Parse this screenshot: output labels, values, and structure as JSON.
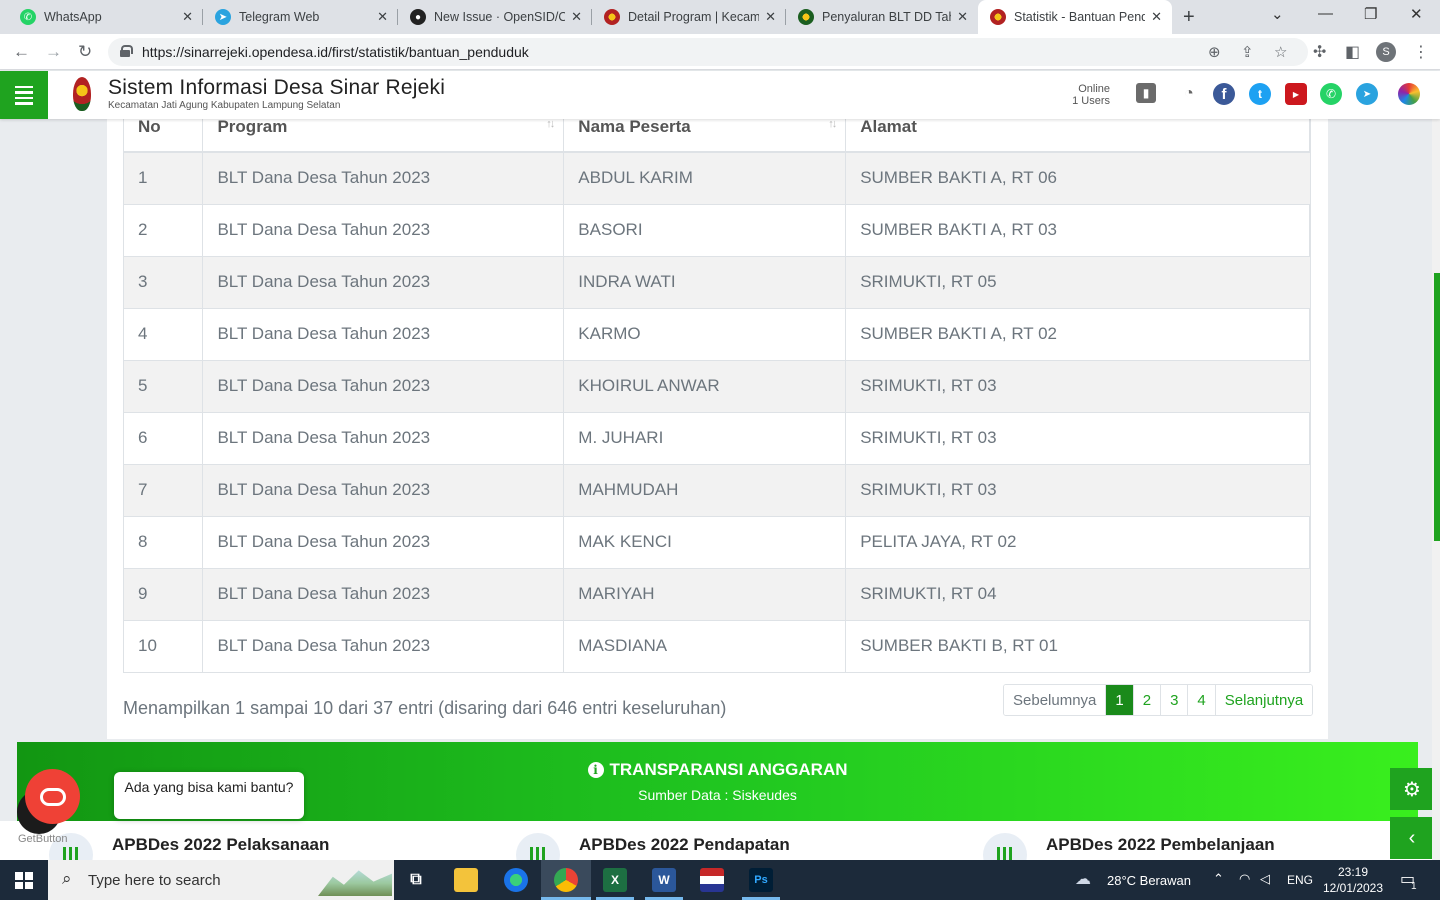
{
  "browser": {
    "tabs": [
      {
        "title": "WhatsApp",
        "icon": "whatsapp-icon",
        "color": "#25d366"
      },
      {
        "title": "Telegram Web",
        "icon": "telegram-icon",
        "color": "#2aa3df"
      },
      {
        "title": "New Issue · OpenSID/Op",
        "icon": "github-icon",
        "color": "#222222"
      },
      {
        "title": "Detail Program | Kecama",
        "icon": "site-favicon",
        "color": "#b22222"
      },
      {
        "title": "Penyaluran BLT DD Tahu",
        "icon": "site-favicon",
        "color": "#b22222"
      },
      {
        "title": "Statistik - Bantuan Pend",
        "icon": "site-favicon",
        "color": "#b22222"
      }
    ],
    "url": "https://sinarrejeki.opendesa.id/first/statistik/bantuan_penduduk",
    "profile_initial": "S"
  },
  "site": {
    "title": "Sistem Informasi Desa Sinar Rejeki",
    "subtitle": "Kecamatan Jati Agung  Kabupaten Lampung Selatan",
    "online_label": "Online",
    "online_users": "1 Users"
  },
  "table": {
    "headers": {
      "no": "No",
      "program": "Program",
      "nama": "Nama Peserta",
      "alamat": "Alamat"
    },
    "rows": [
      {
        "no": "1",
        "program": "BLT Dana Desa Tahun 2023",
        "nama": "ABDUL KARIM",
        "alamat": "SUMBER BAKTI A, RT 06"
      },
      {
        "no": "2",
        "program": "BLT Dana Desa Tahun 2023",
        "nama": "BASORI",
        "alamat": "SUMBER BAKTI A, RT 03"
      },
      {
        "no": "3",
        "program": "BLT Dana Desa Tahun 2023",
        "nama": "INDRA WATI",
        "alamat": "SRIMUKTI, RT 05"
      },
      {
        "no": "4",
        "program": "BLT Dana Desa Tahun 2023",
        "nama": "KARMO",
        "alamat": "SUMBER BAKTI A, RT 02"
      },
      {
        "no": "5",
        "program": "BLT Dana Desa Tahun 2023",
        "nama": "KHOIRUL ANWAR",
        "alamat": "SRIMUKTI, RT 03"
      },
      {
        "no": "6",
        "program": "BLT Dana Desa Tahun 2023",
        "nama": "M. JUHARI",
        "alamat": "SRIMUKTI, RT 03"
      },
      {
        "no": "7",
        "program": "BLT Dana Desa Tahun 2023",
        "nama": "MAHMUDAH",
        "alamat": "SRIMUKTI, RT 03"
      },
      {
        "no": "8",
        "program": "BLT Dana Desa Tahun 2023",
        "nama": "MAK KENCI",
        "alamat": "PELITA JAYA, RT 02"
      },
      {
        "no": "9",
        "program": "BLT Dana Desa Tahun 2023",
        "nama": "MARIYAH",
        "alamat": "SRIMUKTI, RT 04"
      },
      {
        "no": "10",
        "program": "BLT Dana Desa Tahun 2023",
        "nama": "MASDIANA",
        "alamat": "SUMBER BAKTI B, RT 01"
      }
    ],
    "info": "Menampilkan 1 sampai 10 dari 37 entri (disaring dari 646 entri keseluruhan)"
  },
  "pagination": {
    "prev": "Sebelumnya",
    "pages": [
      "1",
      "2",
      "3",
      "4"
    ],
    "active": "1",
    "next": "Selanjutnya"
  },
  "transparansi": {
    "title": "TRANSPARANSI ANGGARAN",
    "source": "Sumber Data : Siskeudes",
    "items": [
      "APBDes 2022 Pelaksanaan",
      "APBDes 2022 Pendapatan",
      "APBDes 2022 Pembelanjaan"
    ]
  },
  "chat": {
    "popup": "Ada yang bisa kami bantu?",
    "brand": "GetButton"
  },
  "taskbar": {
    "search_placeholder": "Type here to search",
    "weather": "28°C  Berawan",
    "lang": "ENG",
    "time": "23:19",
    "date": "12/01/2023",
    "notifications": "1"
  },
  "colors": {
    "brand_green": "#1fa31f",
    "pager_active": "#1a8a1a",
    "chat_red": "#ef4136"
  }
}
